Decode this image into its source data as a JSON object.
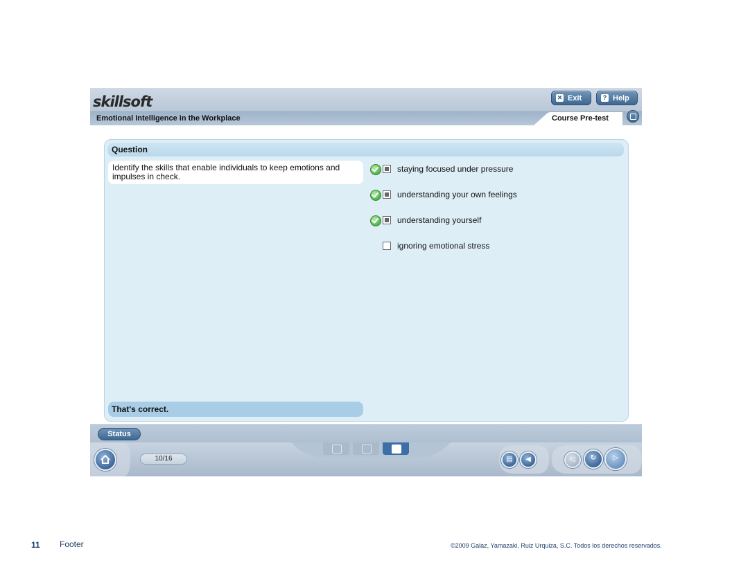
{
  "app": {
    "logo_text": "skillsoft",
    "course_title": "Emotional Intelligence in the Workplace",
    "active_tab": "Course Pre-test",
    "exit_label": "Exit",
    "help_label": "Help"
  },
  "question": {
    "header": "Question",
    "text": "Identify the skills that enable individuals to keep emotions and impulses in check.",
    "options": [
      {
        "label": "staying focused under pressure",
        "checked": true,
        "correct_mark": true
      },
      {
        "label": "understanding your own feelings",
        "checked": true,
        "correct_mark": true
      },
      {
        "label": "understanding yourself",
        "checked": true,
        "correct_mark": true
      },
      {
        "label": "ignoring emotional stress",
        "checked": false,
        "correct_mark": false
      }
    ],
    "feedback": "That's correct."
  },
  "bottom": {
    "status_label": "Status",
    "page_counter": "10/16"
  },
  "slide_footer": {
    "page_number": "11",
    "footer_label": "Footer",
    "copyright": "©2009 Galaz, Yamazaki, Ruiz Urquiza, S.C. Todos los derechos reservados."
  },
  "icons": [
    "exit-icon",
    "help-icon",
    "popout-icon",
    "check-icon",
    "home-icon",
    "list-icon",
    "cc-icon",
    "document-icon",
    "transcript-icon",
    "audio-icon",
    "back-icon",
    "replay-icon",
    "next-icon"
  ]
}
